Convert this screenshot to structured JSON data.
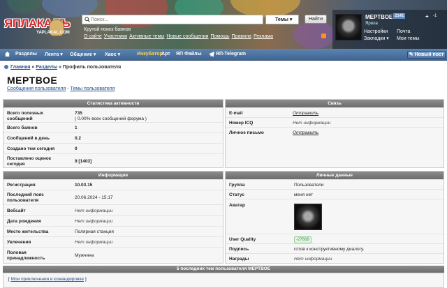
{
  "header": {
    "logo_text": "ЯПЛАКАЛЪ",
    "logo_domain": "YAPLAKAL.COM",
    "search_placeholder": "Поиск...",
    "themes_label": "Темы",
    "find_label": "Найти",
    "tagline": "Крутой поиск баянов",
    "links": [
      "О сайте",
      "Участники",
      "Активные темы",
      "Новые сообщения",
      "Помощь",
      "Правила",
      "Реклама"
    ],
    "colors": {
      "logo_red": "#d8262b",
      "nav_blue": "#4f76a3"
    }
  },
  "user": {
    "name": "МЕРТВОЕ",
    "count": "2141",
    "plus": "+",
    "karma": "-1",
    "role": "Ярила",
    "links": [
      [
        "Настройки",
        "Почта"
      ],
      [
        "Закладки ▾",
        "Мои темы"
      ]
    ]
  },
  "nav": {
    "items": [
      "Разделы",
      "Лента ▾",
      "Общение ▾",
      "Хаос ▾",
      "Инкубатор",
      "Арт",
      "ЯП Файлы",
      "ЯП-Telegram"
    ],
    "new_post": "Новый пост"
  },
  "breadcrumb": {
    "home": "Главная",
    "sections": "Разделы",
    "current": "» Профиль пользователя",
    "sep": "»"
  },
  "page_title": "МЕРТВОЕ",
  "sublinks": {
    "posts": "Сообщения пользователя",
    "sep": " - ",
    "topics": "Темы пользователя"
  },
  "activity": {
    "title": "Статистика активности",
    "rows": [
      {
        "k": "Всего полезных сообщений",
        "v": "735",
        "note": "( 0.00% всех сообщений форума )"
      },
      {
        "k": "Всего баянов",
        "v": "1"
      },
      {
        "k": "Сообщений в день",
        "v": "0.2"
      },
      {
        "k": "Создано тем сегодня",
        "v": "0"
      },
      {
        "k": "Поставлено оценок сегодня",
        "v": "9 [1403]"
      }
    ]
  },
  "contact": {
    "title": "Связь",
    "rows": [
      {
        "k": "E-mail",
        "v": "Отправить"
      },
      {
        "k": "Номер ICQ",
        "v": "Нет информации"
      },
      {
        "k": "Личное письмо",
        "v": "Отправить"
      }
    ]
  },
  "info": {
    "title": "Информация",
    "rows": [
      {
        "k": "Регистрация",
        "v": "10.03.15"
      },
      {
        "k": "Последний пояс пользователя",
        "v": "20.06.2024 - 15:17"
      },
      {
        "k": "Вебсайт",
        "v": "Нет информации"
      },
      {
        "k": "Дата рождения",
        "v": "Нет информации"
      },
      {
        "k": "Место жительства",
        "v": "Полярная станция"
      },
      {
        "k": "Увлечения",
        "v": "Нет информации"
      },
      {
        "k": "Половая принадлежность",
        "v": "Мужчина"
      }
    ]
  },
  "personal": {
    "title": "Личные данные",
    "rows": [
      {
        "k": "Группа",
        "v": "Пользователи"
      },
      {
        "k": "Статус",
        "v": "меня нет"
      },
      {
        "k": "Аватар",
        "v": ""
      },
      {
        "k": "User Quality",
        "v": "-27668"
      },
      {
        "k": "Подпись",
        "v": "готов к конструктивному диалогу."
      },
      {
        "k": "Награды",
        "v": "Нет информации"
      }
    ]
  },
  "recent": {
    "title": "5 последних тем пользователя МЕРТВОЕ",
    "item": "Мои приключения в командировке",
    "lb": "[",
    "rb": "]"
  }
}
